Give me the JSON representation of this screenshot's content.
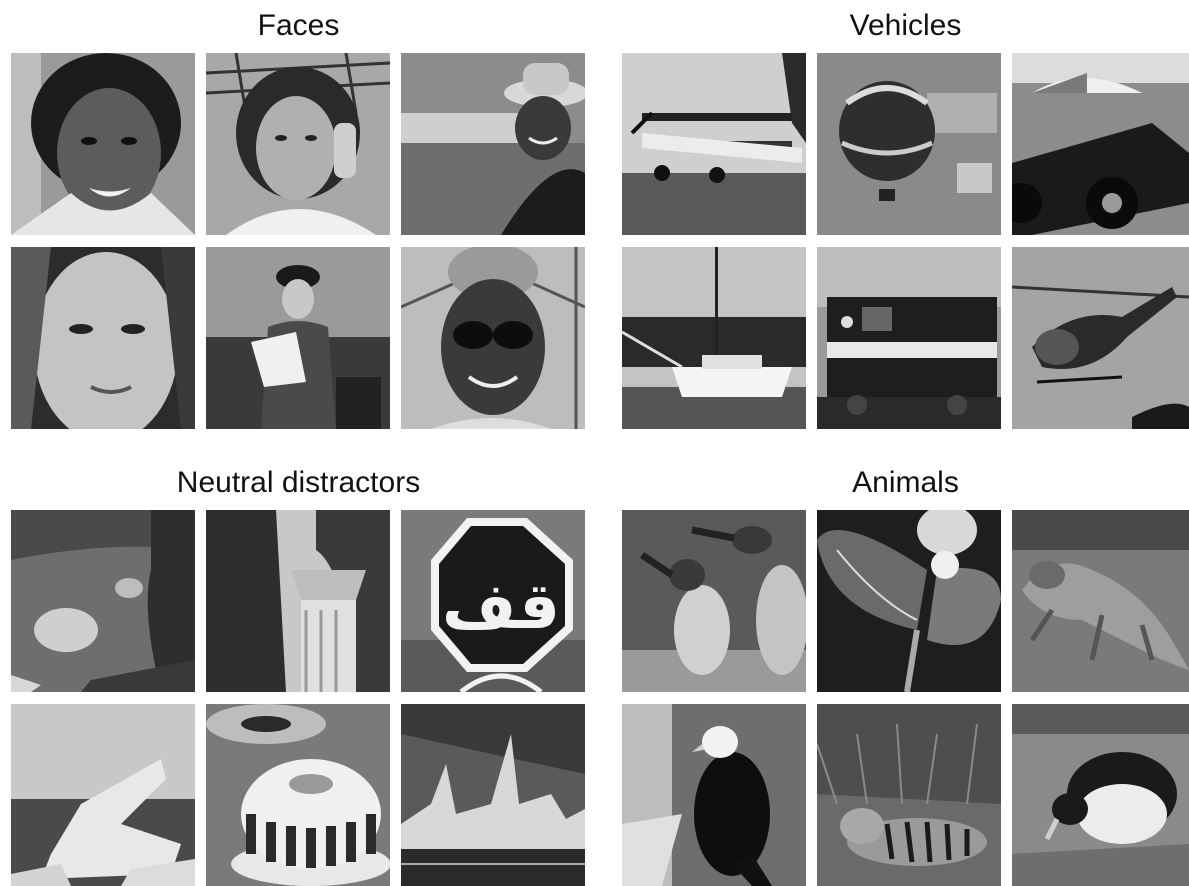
{
  "groups": {
    "faces": {
      "title": "Faces"
    },
    "vehicles": {
      "title": "Vehicles"
    },
    "neutral": {
      "title": "Neutral distractors"
    },
    "animals": {
      "title": "Animals"
    }
  },
  "sign_text": "قف"
}
